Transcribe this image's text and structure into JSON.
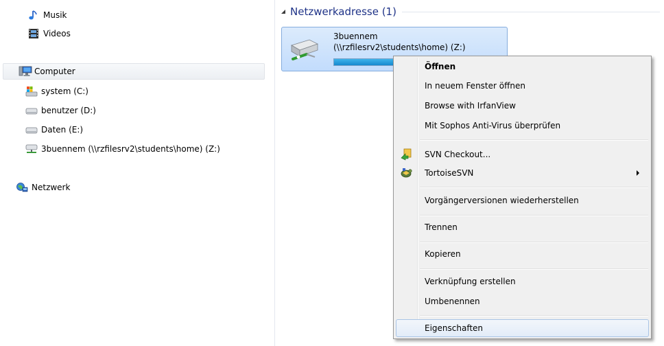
{
  "nav": {
    "items": [
      {
        "label": "Musik",
        "icon": "music-note-icon"
      },
      {
        "label": "Videos",
        "icon": "film-strip-icon"
      },
      {
        "label": "Computer",
        "icon": "computer-icon"
      },
      {
        "label": "system (C:)",
        "icon": "system-drive-icon"
      },
      {
        "label": "benutzer (D:)",
        "icon": "drive-icon"
      },
      {
        "label": "Daten (E:)",
        "icon": "drive-icon"
      },
      {
        "label": "3buennem (\\\\rzfilesrv2\\students\\home) (Z:)",
        "icon": "network-drive-icon"
      },
      {
        "label": "Netzwerk",
        "icon": "network-globe-icon"
      }
    ],
    "selected": "Computer"
  },
  "content": {
    "group_title": "Netzwerkadresse (1)",
    "drive": {
      "name": "3buennem",
      "path": "(\\\\rzfilesrv2\\students\\home) (Z:)",
      "usage_fraction": 0.95
    }
  },
  "context_menu": {
    "open": "Öffnen",
    "open_new_window": "In neuem Fenster öffnen",
    "browse_irfanview": "Browse with IrfanView",
    "sophos_scan": "Mit Sophos Anti-Virus überprüfen",
    "svn_checkout": "SVN Checkout...",
    "tortoise_svn": "TortoiseSVN",
    "restore_previous": "Vorgängerversionen wiederherstellen",
    "disconnect": "Trennen",
    "copy": "Kopieren",
    "create_shortcut": "Verknüpfung erstellen",
    "rename": "Umbenennen",
    "properties": "Eigenschaften"
  },
  "colors": {
    "group_title": "#1e3287",
    "selection_fill": "#c2dcfd",
    "selection_border": "#84acdd",
    "usage_bar": "#1689cf",
    "menu_background": "#f0f0f0"
  }
}
